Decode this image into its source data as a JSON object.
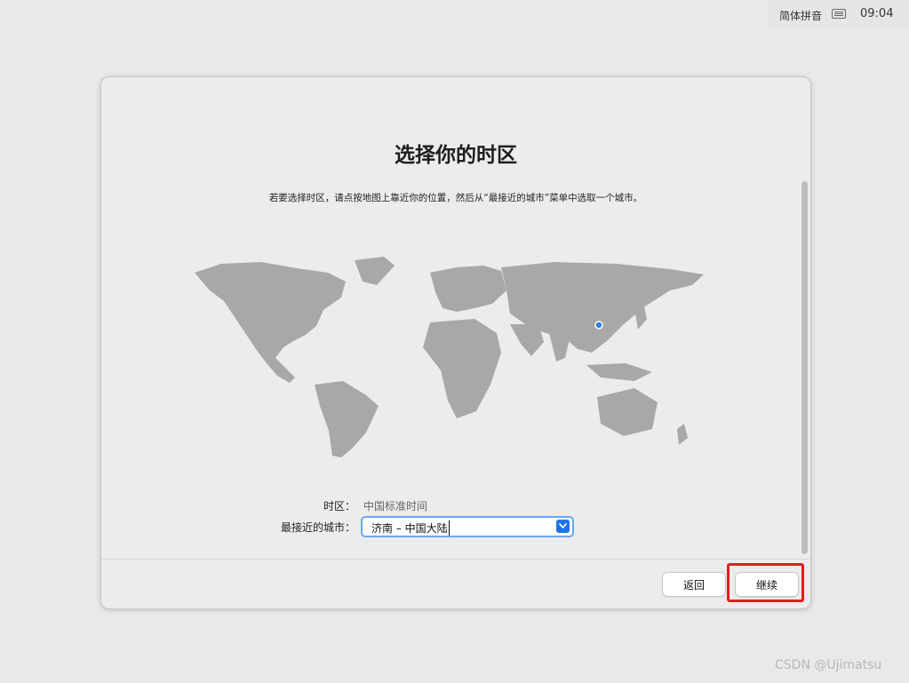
{
  "menubar": {
    "input_method": "简体拼音",
    "keyboard_icon": "keyboard-icon",
    "clock": "09:04"
  },
  "window": {
    "title": "选择你的时区",
    "subtitle": "若要选择时区，请点按地图上靠近你的位置，然后从“最接近的城市”菜单中选取一个城市。",
    "timezone_label": "时区：",
    "timezone_value": "中国标准时间",
    "closest_city_label": "最接近的城市：",
    "closest_city_value": "济南 – 中国大陆",
    "back_label": "返回",
    "continue_label": "继续"
  },
  "map": {
    "selected_marker_color": "#2f7cf6",
    "land_color": "#a8a8a8"
  },
  "annotation": {
    "highlight_color": "#e41c1c"
  },
  "watermark": "CSDN @Ujimatsu"
}
